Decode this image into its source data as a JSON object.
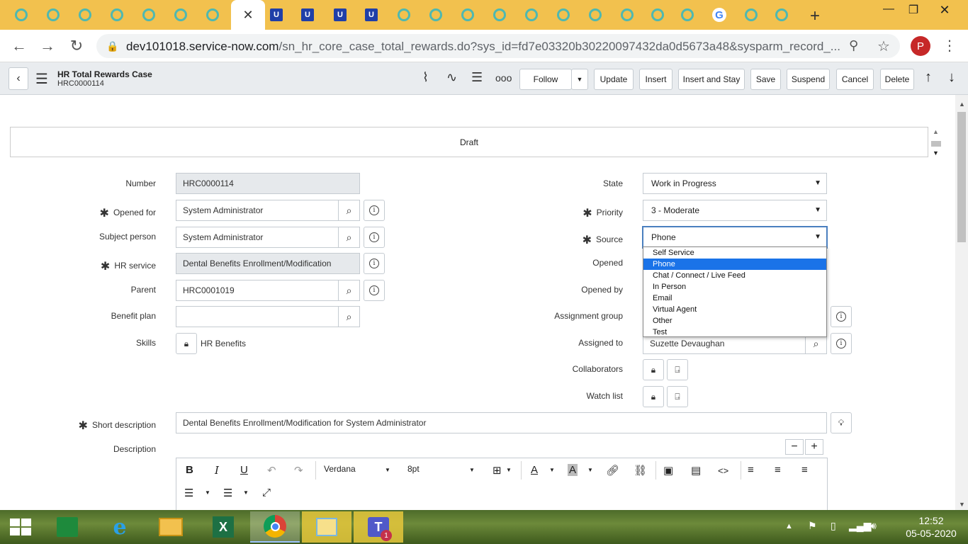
{
  "browser": {
    "url_host": "dev101018.service-now.com",
    "url_path": "/sn_hr_core_case_total_rewards.do?sys_id=fd7e03320b30220097432da0d5673a48&sysparm_record_...",
    "profile_initial": "P",
    "tabs": [
      "o",
      "o",
      "o",
      "o",
      "o",
      "o",
      "o",
      "active",
      "U",
      "U",
      "U",
      "U",
      "o",
      "o",
      "o",
      "o",
      "o",
      "o",
      "o",
      "o",
      "o",
      "o",
      "G",
      "o",
      "o"
    ]
  },
  "header": {
    "record_type": "HR Total Rewards Case",
    "record_number": "HRC0000114",
    "buttons": {
      "follow": "Follow",
      "update": "Update",
      "insert": "Insert",
      "insert_and_stay": "Insert and Stay",
      "save": "Save",
      "suspend": "Suspend",
      "cancel": "Cancel",
      "delete": "Delete"
    }
  },
  "state_bar": {
    "text": "Draft"
  },
  "form": {
    "labels": {
      "number": "Number",
      "opened_for": "Opened for",
      "subject_person": "Subject person",
      "hr_service": "HR service",
      "parent": "Parent",
      "benefit_plan": "Benefit plan",
      "skills": "Skills",
      "state": "State",
      "priority": "Priority",
      "source": "Source",
      "opened": "Opened",
      "opened_by": "Opened by",
      "assignment_group": "Assignment group",
      "assigned_to": "Assigned to",
      "collaborators": "Collaborators",
      "watch_list": "Watch list",
      "short_description": "Short description",
      "description": "Description"
    },
    "values": {
      "number": "HRC0000114",
      "opened_for": "System Administrator",
      "subject_person": "System Administrator",
      "hr_service": "Dental Benefits Enrollment/Modification",
      "parent": "HRC0001019",
      "benefit_plan": "",
      "skills": "HR Benefits",
      "state": "Work in Progress",
      "priority": "3 - Moderate",
      "source": "Phone",
      "assigned_to": "Suzette Devaughan",
      "short_description": "Dental Benefits Enrollment/Modification for System Administrator"
    },
    "source_options": [
      "Self Service",
      "Phone",
      "Chat / Connect / Live Feed",
      "In Person",
      "Email",
      "Virtual Agent",
      "Other",
      "Test"
    ],
    "source_selected_index": 1
  },
  "editor": {
    "font_family": "Verdana",
    "font_size": "8pt"
  },
  "taskbar": {
    "time": "12:52",
    "date": "05-05-2020"
  }
}
